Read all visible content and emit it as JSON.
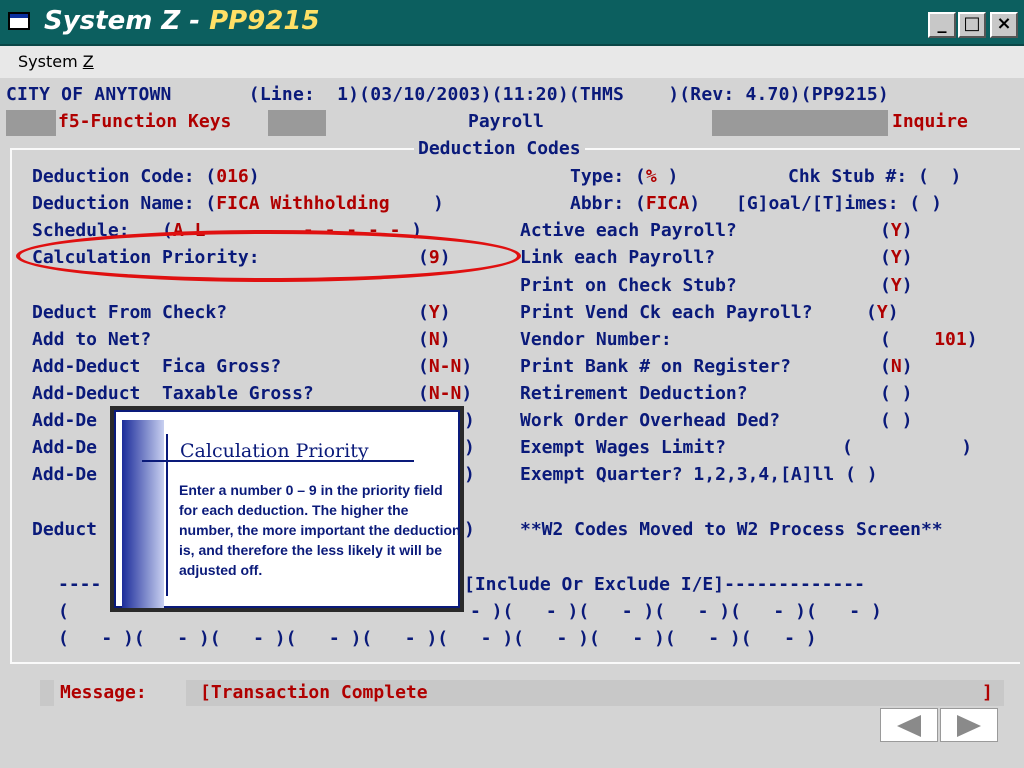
{
  "window": {
    "title_prefix": "System Z - ",
    "title_code": "PP9215",
    "minimize": "_",
    "maximize": "□",
    "close": "×"
  },
  "menu": {
    "label_prefix": "System ",
    "label_mnemonic": "Z"
  },
  "header": {
    "line": "CITY OF ANYTOWN       (Line:  1)(03/10/2003)(11:20)(THMS    )(Rev: 4.70)(PP9215)",
    "fkeys": "f5-Function Keys",
    "module": "Payroll",
    "mode": "Inquire"
  },
  "panel": {
    "title": "Deduction Codes"
  },
  "fields": {
    "deduction_code_label": "Deduction Code: (",
    "deduction_code_value": "016",
    "deduction_code_close": ")",
    "type_label": "Type: (",
    "type_value": "%",
    "type_close": " )",
    "chk_stub_label": "Chk Stub #: (  )",
    "deduction_name_label": "Deduction Name: (",
    "deduction_name_value": "FICA Withholding",
    "deduction_name_close": "    )",
    "abbr_label": "Abbr: (",
    "abbr_value": "FICA",
    "abbr_close": ")",
    "goal_times_label": "[G]oal/[T]imes: ( )",
    "schedule_label": "Schedule:   (",
    "schedule_value": "A L         - - - - -",
    "schedule_close": " )",
    "active_each_payroll_label": "Active each Payroll?",
    "active_each_payroll_value": "Y",
    "calc_priority_label": "Calculation Priority:",
    "calc_priority_value": "9",
    "link_each_payroll_label": "Link each Payroll?",
    "link_each_payroll_value": "Y",
    "print_check_stub_label": "Print on Check Stub?",
    "print_check_stub_value": "Y",
    "deduct_from_check_label": "Deduct From Check?",
    "deduct_from_check_value": "Y",
    "print_vend_ck_label": "Print Vend Ck each Payroll?",
    "print_vend_ck_value": "Y",
    "add_to_net_label": "Add to Net?",
    "add_to_net_value": "N",
    "vendor_number_label": "Vendor Number:",
    "vendor_number_value": "101",
    "add_deduct_fica_label": "Add-Deduct  Fica Gross?",
    "add_deduct_fica_value": "N-N",
    "print_bank_label": "Print Bank # on Register?",
    "print_bank_value": "N",
    "add_deduct_taxable_label": "Add-Deduct  Taxable Gross?",
    "add_deduct_taxable_value": "N-N",
    "retirement_label": "Retirement Deduction?",
    "retirement_value": "( )",
    "add_de_1": "Add-De",
    "work_order_label": "Work Order Overhead Ded?",
    "work_order_value": "( )",
    "add_de_2": "Add-De",
    "exempt_wages_label": "Exempt Wages Limit?",
    "exempt_wages_value": "(          )",
    "add_de_3": "Add-De",
    "exempt_quarter_label": "Exempt Quarter? 1,2,3,4,[A]ll ( )",
    "deduct_partial": "Deduct",
    "w2_note": "**W2 Codes Moved to W2 Process Screen**",
    "include_exclude": "[Include Or Exclude I/E]-------------",
    "dash_start": "----",
    "slots_row1_left": "(",
    "slots_row1_right": "- )(   - )(   - )(   - )(   - )(   - )",
    "slots_row2": "(   - )(   - )(   - )(   - )(   - )(   - )(   - )(   - )(   - )(   - )"
  },
  "callout": {
    "title": "Calculation Priority",
    "body": "Enter a number 0 – 9 in the priority field for each deduction.  The higher the number, the more important the deduction is, and therefore the less likely it will be adjusted off."
  },
  "message": {
    "label": "Message:",
    "text": "[Transaction Complete",
    "end": "]"
  },
  "colors": {
    "label": "#0a1a7a",
    "value": "#b00000",
    "highlight": "#e01010"
  },
  "icons": {
    "back": "triangle-left-icon",
    "forward": "triangle-right-icon"
  }
}
